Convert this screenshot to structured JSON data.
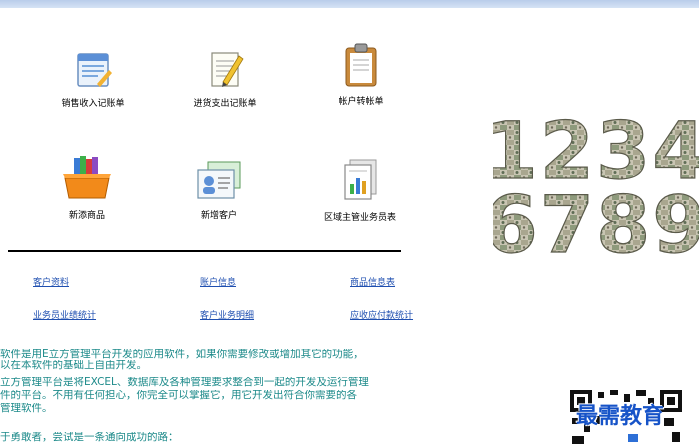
{
  "tiles": [
    {
      "label": "销售收入记账单",
      "icon": "ledger-form-icon"
    },
    {
      "label": "进货支出记账单",
      "icon": "notepad-pencil-icon"
    },
    {
      "label": "帐户转帐单",
      "icon": "clipboard-icon"
    },
    {
      "label": "新添商品",
      "icon": "books-box-icon"
    },
    {
      "label": "新增客户",
      "icon": "contact-card-icon"
    },
    {
      "label": "区域主管业务员表",
      "icon": "report-chart-icon"
    }
  ],
  "links": {
    "customer_info": "客户资料",
    "account_info": "账户信息",
    "product_info": "商品信息表",
    "sales_performance": "业务员业绩统计",
    "customer_business": "客户业务明细",
    "receivable_payable": "应收应付款统计"
  },
  "description": {
    "line1": "软件是用E立方管理平台开发的应用软件，如果你需要修改或增加其它的功能，",
    "line2": "以在本软件的基础上自由开发。",
    "line3": "立方管理平台是将EXCEL、数据库及各种管理要求整合到一起的开发及运行管理",
    "line4": "件的平台。不用有任何担心，你完全可以掌握它，用它开发出符合你需要的各",
    "line5": "管理软件。",
    "line6": "于勇敢者，尝试是一条通向成功的路："
  },
  "decor": {
    "digits_row1": "1234",
    "digits_row2": "6789"
  },
  "watermark": {
    "brand": "最需教育"
  },
  "colors": {
    "link": "#1f4fb0",
    "description": "#1d8a8a",
    "topbar": "#c6d6ee",
    "brand": "#1653c8"
  }
}
